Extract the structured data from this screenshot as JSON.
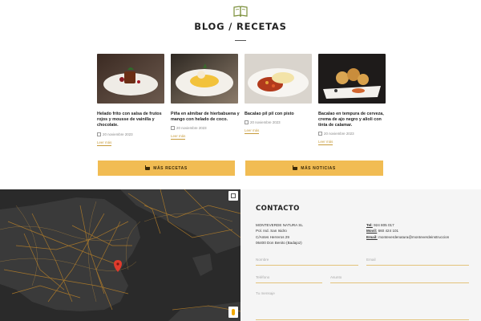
{
  "blog": {
    "title": "BLOG / RECETAS",
    "icon": "book-icon",
    "accent": "#f1bc53",
    "cards": [
      {
        "desc": "Helado frito con salsa de frutos rojos y mousse de vainilla y chocolate.",
        "date": "20 noviembre 2023",
        "more": "Leer más"
      },
      {
        "desc": "Piña en almíbar de hierbabuena y mango con helado de coco.",
        "date": "20 noviembre 2023",
        "more": "Leer más"
      },
      {
        "desc": "Bacalao pil pil con pisto",
        "date": "20 noviembre 2023",
        "more": "Leer más"
      },
      {
        "desc": "Bacalao en tempura de cerveza, crema de ajo negro y alioli con tinta de calamar.",
        "date": "20 noviembre 2023",
        "more": "Leer más"
      }
    ],
    "buttons": {
      "recipes": "MÁS RECETAS",
      "news": "MÁS NOTICIAS"
    }
  },
  "contact": {
    "title": "CONTACTO",
    "company": "MONTEVERDE NATURA SL",
    "address1": "Pol. Ind. San Isidro",
    "address2": "C/Antes Herreros 29",
    "address3": "06400 Don Benito (Badajoz)",
    "tel_label": "Tel:",
    "tel_value": "924 805 017",
    "movil_label": "Movil:",
    "movil_value": "660 424 101",
    "email_label": "Email:",
    "email_value": "monteverdenatura@monteverdeinstruccion",
    "fields": {
      "name": "Nombre",
      "email": "Email",
      "phone": "Teléfono",
      "subject": "Asunto",
      "message": "Tu mensaje"
    }
  }
}
